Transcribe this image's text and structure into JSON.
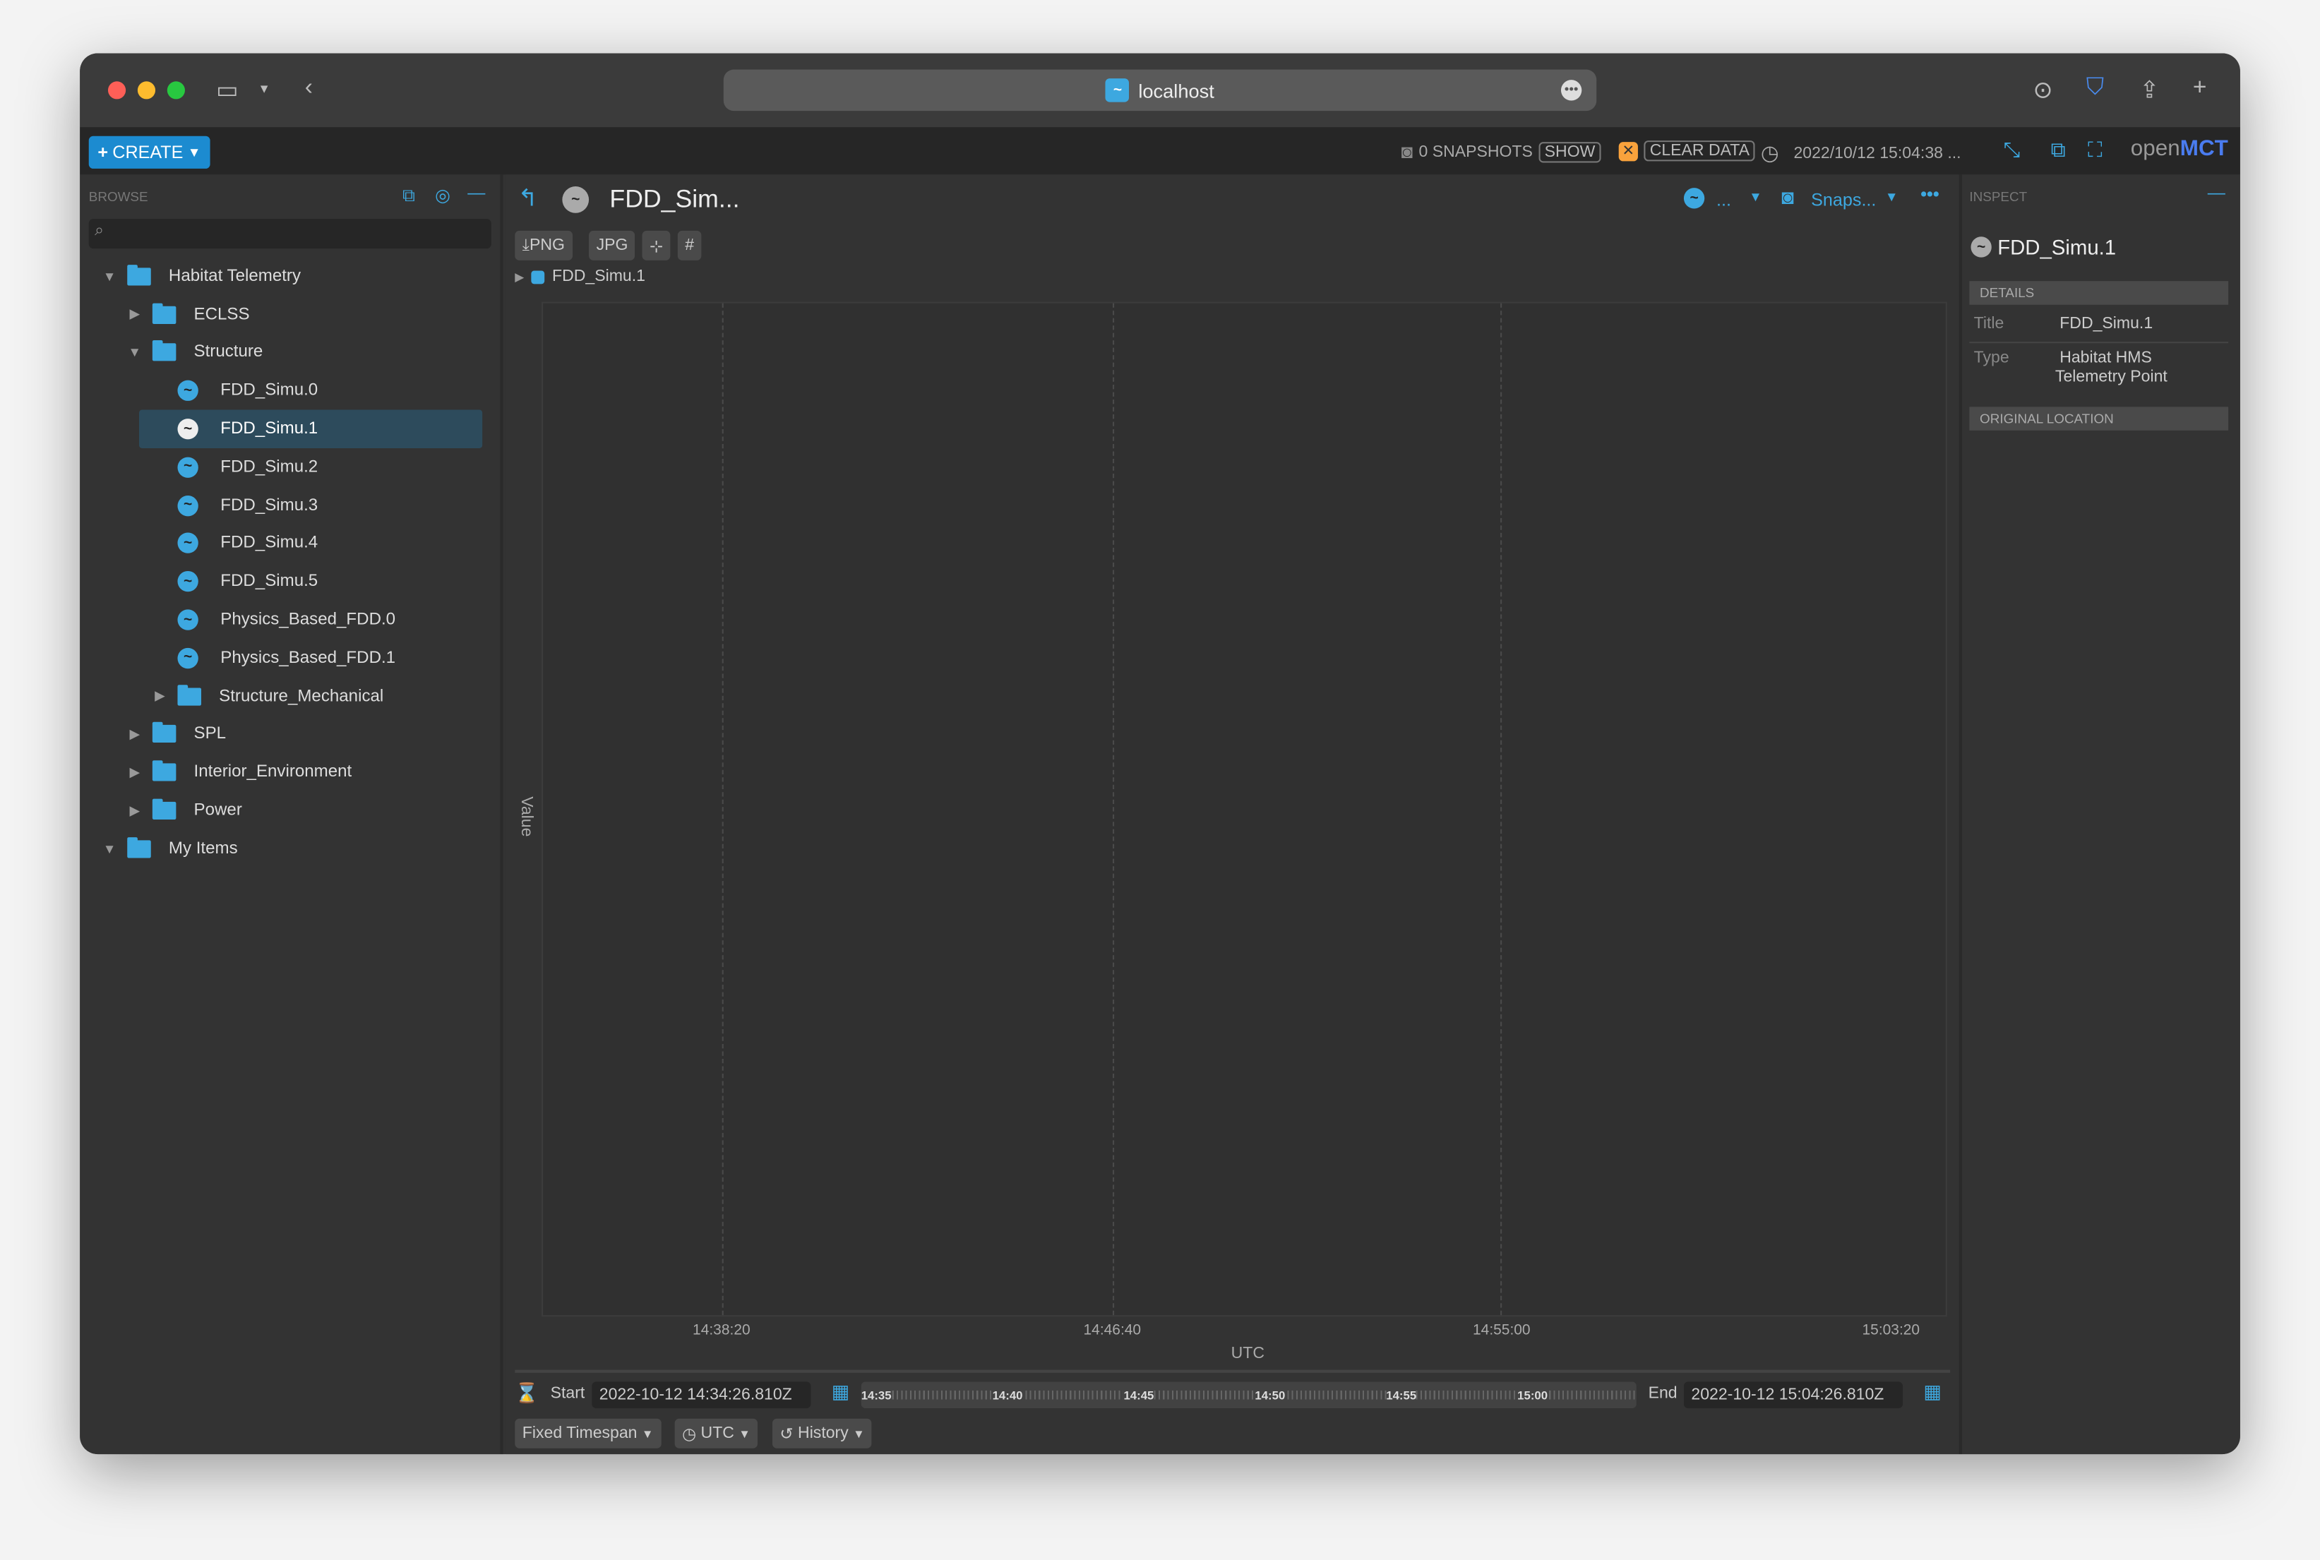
{
  "browser": {
    "url": "localhost"
  },
  "header": {
    "create_label": "CREATE",
    "snapshots": "0 SNAPSHOTS",
    "show_label": "SHOW",
    "clear_data_label": "CLEAR DATA",
    "clock": "2022/10/12 15:04:38 ...",
    "logo_open": "open",
    "logo_mct": "MCT"
  },
  "browse": {
    "label": "BROWSE",
    "search_placeholder": "",
    "tree": [
      {
        "label": "Habitat Telemetry",
        "level": 0,
        "type": "folder",
        "expanded": true
      },
      {
        "label": "ECLSS",
        "level": 1,
        "type": "folder",
        "expanded": false
      },
      {
        "label": "Structure",
        "level": 1,
        "type": "folder",
        "expanded": true
      },
      {
        "label": "FDD_Simu.0",
        "level": 2,
        "type": "telemetry"
      },
      {
        "label": "FDD_Simu.1",
        "level": 2,
        "type": "telemetry",
        "selected": true
      },
      {
        "label": "FDD_Simu.2",
        "level": 2,
        "type": "telemetry"
      },
      {
        "label": "FDD_Simu.3",
        "level": 2,
        "type": "telemetry"
      },
      {
        "label": "FDD_Simu.4",
        "level": 2,
        "type": "telemetry"
      },
      {
        "label": "FDD_Simu.5",
        "level": 2,
        "type": "telemetry"
      },
      {
        "label": "Physics_Based_FDD.0",
        "level": 2,
        "type": "telemetry"
      },
      {
        "label": "Physics_Based_FDD.1",
        "level": 2,
        "type": "telemetry"
      },
      {
        "label": "Structure_Mechanical",
        "level": 2,
        "type": "folder",
        "expanded": false
      },
      {
        "label": "SPL",
        "level": 1,
        "type": "folder",
        "expanded": false
      },
      {
        "label": "Interior_Environment",
        "level": 1,
        "type": "folder",
        "expanded": false
      },
      {
        "label": "Power",
        "level": 1,
        "type": "folder",
        "expanded": false
      },
      {
        "label": "My Items",
        "level": 0,
        "type": "folder",
        "expanded": true
      }
    ]
  },
  "main": {
    "title": "FDD_Sim...",
    "view_label": "...",
    "snapshot_label": "Snaps...",
    "png": "PNG",
    "jpg": "JPG",
    "legend": "FDD_Simu.1",
    "legend_color": "#3da8e0",
    "plot": {
      "ylabel": "Value",
      "xlabel": "UTC",
      "xticks": [
        "14:38:20",
        "14:46:40",
        "14:55:00",
        "15:03:20"
      ]
    },
    "time": {
      "start_label": "Start",
      "start": "2022-10-12 14:34:26.810Z",
      "end_label": "End",
      "end": "2022-10-12 15:04:26.810Z",
      "ticks": [
        "14:35",
        "14:40",
        "14:45",
        "14:50",
        "14:55",
        "15:00"
      ],
      "mode": "Fixed Timespan",
      "timesystem": "UTC",
      "clock": "History"
    }
  },
  "inspect": {
    "label": "INSPECT",
    "object": "FDD_Simu.1",
    "details": "DETAILS",
    "title_key": "Title",
    "title_val": "FDD_Simu.1",
    "type_key": "Type",
    "type_val1": "Habitat HMS",
    "type_val2": "Telemetry Point",
    "original_location": "ORIGINAL LOCATION"
  }
}
